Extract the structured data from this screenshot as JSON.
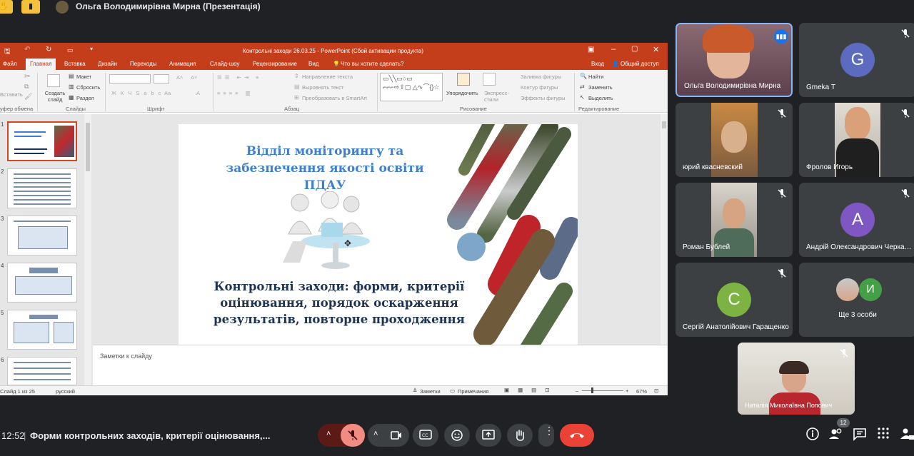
{
  "top": {
    "presenter_title": "Ольга Володимирівна Мирна (Презентація)"
  },
  "ppt": {
    "window_title": "Контрольні заходи 26.03.25 - PowerPoint (Сбой активации продукта)",
    "tabs": [
      "Файл",
      "Главная",
      "Вставка",
      "Дизайн",
      "Переходы",
      "Анимация",
      "Слайд-шоу",
      "Рецензирование",
      "Вид"
    ],
    "tell_me": "Что вы хотите сделать?",
    "sign_in": "Вход",
    "share": "Общий доступ",
    "ribbon": {
      "paste": "Вставить",
      "new_slide": "Создать слайд",
      "layout": "Макет",
      "reset": "Сбросить",
      "section": "Раздел",
      "text_direction": "Направление текста",
      "align_text": "Выровнять текст",
      "smartart": "Преобразовать в SmartArt",
      "arrange": "Упорядочить",
      "quick_styles": "Экспресс-стили",
      "shape_fill": "Заливка фигуры",
      "shape_outline": "Контур фигуры",
      "shape_effects": "Эффекты фигуры",
      "find": "Найти",
      "replace": "Заменить",
      "select": "Выделить",
      "groups": [
        "уфер обмена",
        "Слайды",
        "Шрифт",
        "Абзац",
        "Рисование",
        "Редактирование"
      ]
    },
    "thumbs": [
      "1",
      "2",
      "3",
      "4",
      "5",
      "6"
    ],
    "slide": {
      "heading": "Відділ моніторингу та забезпечення якості освіти ПДАУ",
      "subtitle": "Контрольні заходи: форми, критерії оцінювання, порядок оскарження результатів, повторне проходження"
    },
    "notes_placeholder": "Заметки к слайду",
    "status": {
      "slide_info": "Слайд 1 из 25",
      "language": "русский",
      "notes": "Заметки",
      "comments": "Примечания",
      "zoom": "67%"
    }
  },
  "participants": [
    {
      "name": "Ольга Володимирівна Мирна",
      "speaking": true
    },
    {
      "name": "Gmeka T",
      "initial": "G",
      "color": "#5c6bc0"
    },
    {
      "name": "юрий квасневский"
    },
    {
      "name": "Фролов Игорь"
    },
    {
      "name": "Роман Бублей"
    },
    {
      "name": "Андрій Олександрович Черкасов",
      "initial": "A",
      "color": "#7e57c2"
    },
    {
      "name": "Сергій Анатолійович Гаращенко",
      "initial": "C",
      "color": "#7cb342"
    },
    {
      "name": "Ще 3 особи",
      "initial": "И",
      "color": "#43a047"
    },
    {
      "name": "Наталія Миколаївна Попович"
    }
  ],
  "bottom": {
    "clock": "12:52",
    "meeting_title": "Форми контрольних заходів, критерії оцінювання,...",
    "participants_count": "12"
  },
  "colors": {
    "accent_red": "#ea4335",
    "ppt_red": "#c43e1c",
    "meet_bg": "#202124"
  }
}
